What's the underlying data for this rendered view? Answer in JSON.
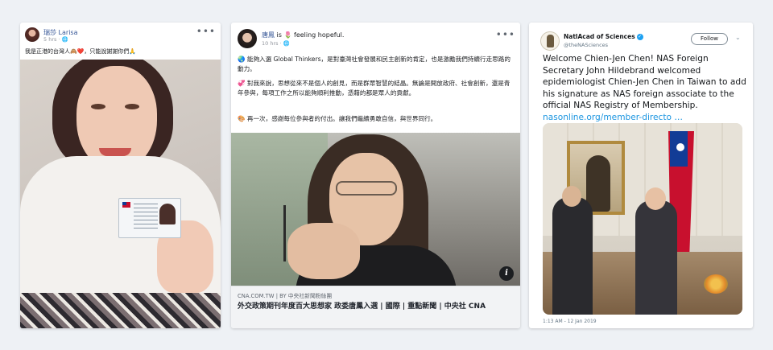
{
  "posts": [
    {
      "author": "瑞莎 Larisa",
      "time": "5 hrs",
      "privacy_icon": "globe-icon",
      "text": "我是正港的台灣人🙈❤️，只能說謝謝你們🙏"
    },
    {
      "author": "唐鳳",
      "is": "is",
      "emoji": "🌷",
      "feeling": "feeling hopeful.",
      "time": "10 hrs",
      "paragraphs": [
        "🌏 能夠入選 Global Thinkers，是對臺灣社會發展和民主創新的肯定，也是激勵我們持續行走思路的動力。",
        "💞 對我來說，思想從來不是個人的創見，而是群眾智慧的結晶。無論是開放政府、社會創新，還是青年參與，每項工作之所以能夠順利推動，憑藉的都是眾人的貢獻。",
        "🎨 再一次，感謝每位參與者的付出。讓我們繼續勇敢自信，與世界同行。"
      ],
      "link": {
        "domain": "CNA.COM.TW",
        "separator": "|",
        "source": "BY 中央社新聞粉絲團",
        "title": "外交政策期刊年度百大思想家 政委唐鳳入選 | 國際 | 重點新聞 | 中央社 CNA",
        "info_glyph": "i"
      }
    },
    {
      "author": "NatlAcad of Sciences",
      "verified_glyph": "✓",
      "handle": "@theNASciences",
      "follow_label": "Follow",
      "chevron": "⌄",
      "text": "Welcome Chien-Jen Chen! NAS Foreign Secretary John Hildebrand welcomed epidemiologist Chien-Jen Chen in Taiwan to add his signature as NAS foreign associate to the official NAS Registry of Membership.",
      "link_text": "nasonline.org/member-directo …",
      "timestamp": "1:13 AM - 12 Jan 2019"
    }
  ],
  "ui": {
    "more_glyph": "•••"
  }
}
